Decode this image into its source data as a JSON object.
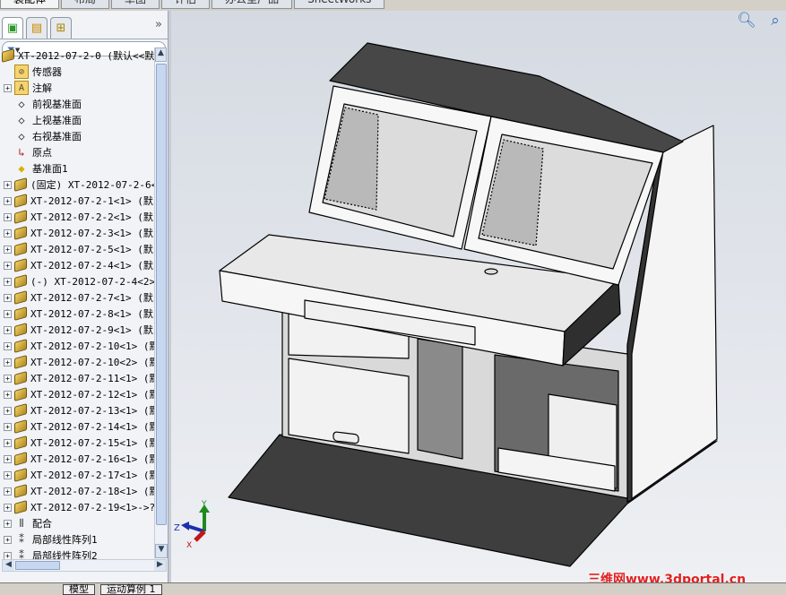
{
  "command_tabs": [
    "装配体",
    "布局",
    "草图",
    "评估",
    "办公室产品",
    "SheetWorks"
  ],
  "panel_tabs": [
    {
      "icon": "feature-manager-icon"
    },
    {
      "icon": "property-manager-icon"
    },
    {
      "icon": "configuration-manager-icon"
    }
  ],
  "panel_more": "»",
  "filter_icon": "▼",
  "tree": [
    {
      "label": "XT-2012-07-2-0  (默认<<默",
      "icon": "assembly",
      "expand": false,
      "root": true
    },
    {
      "label": "传感器",
      "icon": "sensor-folder"
    },
    {
      "label": "注解",
      "icon": "annotation-folder",
      "expand": true
    },
    {
      "label": "前视基准面",
      "icon": "plane"
    },
    {
      "label": "上视基准面",
      "icon": "plane"
    },
    {
      "label": "右视基准面",
      "icon": "plane"
    },
    {
      "label": "原点",
      "icon": "origin"
    },
    {
      "label": "基准面1",
      "icon": "plane-yellow"
    },
    {
      "label": "(固定) XT-2012-07-2-6<",
      "icon": "part",
      "expand": true
    },
    {
      "label": "XT-2012-07-2-1<1> (默i",
      "icon": "part",
      "expand": true
    },
    {
      "label": "XT-2012-07-2-2<1> (默i",
      "icon": "part",
      "expand": true
    },
    {
      "label": "XT-2012-07-2-3<1> (默i",
      "icon": "part",
      "expand": true
    },
    {
      "label": "XT-2012-07-2-5<1> (默i",
      "icon": "part",
      "expand": true
    },
    {
      "label": "XT-2012-07-2-4<1> (默i",
      "icon": "part",
      "expand": true
    },
    {
      "label": "(-) XT-2012-07-2-4<2>",
      "icon": "part",
      "expand": true
    },
    {
      "label": "XT-2012-07-2-7<1> (默i",
      "icon": "part",
      "expand": true
    },
    {
      "label": "XT-2012-07-2-8<1> (默i",
      "icon": "part",
      "expand": true
    },
    {
      "label": "XT-2012-07-2-9<1> (默i",
      "icon": "part",
      "expand": true
    },
    {
      "label": "XT-2012-07-2-10<1> (默",
      "icon": "part",
      "expand": true
    },
    {
      "label": "XT-2012-07-2-10<2> (默",
      "icon": "part",
      "expand": true
    },
    {
      "label": "XT-2012-07-2-11<1> (默",
      "icon": "part",
      "expand": true
    },
    {
      "label": "XT-2012-07-2-12<1> (默",
      "icon": "part",
      "expand": true
    },
    {
      "label": "XT-2012-07-2-13<1> (默",
      "icon": "part",
      "expand": true
    },
    {
      "label": "XT-2012-07-2-14<1> (默",
      "icon": "subassembly",
      "expand": true
    },
    {
      "label": "XT-2012-07-2-15<1> (默",
      "icon": "part",
      "expand": true
    },
    {
      "label": "XT-2012-07-2-16<1> (默",
      "icon": "part",
      "expand": true
    },
    {
      "label": "XT-2012-07-2-17<1> (默",
      "icon": "part",
      "expand": true
    },
    {
      "label": "XT-2012-07-2-18<1> (默",
      "icon": "part",
      "expand": true
    },
    {
      "label": "XT-2012-07-2-19<1>->?",
      "icon": "part",
      "expand": true
    },
    {
      "label": "配合",
      "icon": "mates",
      "expand": true
    },
    {
      "label": "局部线性阵列1",
      "icon": "pattern",
      "expand": true
    },
    {
      "label": "局部线性阵列2",
      "icon": "pattern",
      "expand": true
    }
  ],
  "bottom_tabs": [
    "模型",
    "运动算例 1"
  ],
  "view_tools": [
    "zoom-to-fit-icon",
    "zoom-to-area-icon",
    "previous-view-icon",
    "section-view-icon",
    "view-orientation-icon",
    "display-style-icon",
    "hide-show-items-icon"
  ],
  "triad": {
    "x": "X",
    "y": "Y",
    "z": "Z"
  },
  "watermark": "三维网www.3dportal.cn"
}
